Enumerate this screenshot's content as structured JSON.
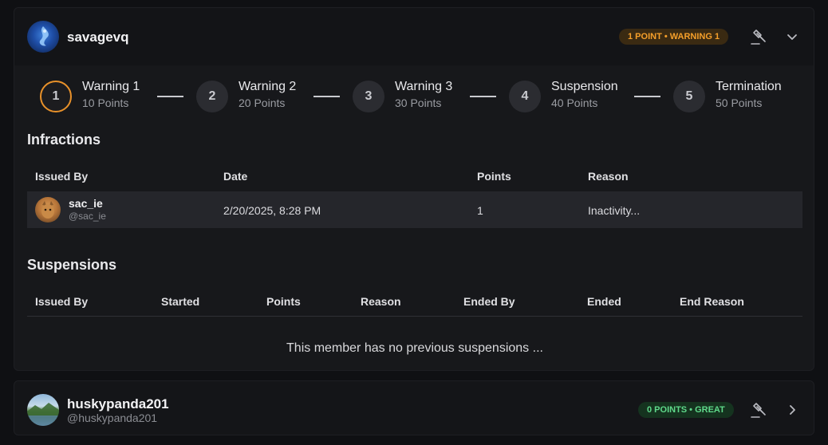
{
  "members": [
    {
      "username": "savagevq",
      "badge": "1 POINT • WARNING 1",
      "badge_color": "#f59f2a",
      "expanded": true
    },
    {
      "username": "huskypanda201",
      "handle": "@huskypanda201",
      "badge": "0 POINTS • GREAT",
      "badge_color": "#5fd98a",
      "expanded": false
    }
  ],
  "stepper": [
    {
      "number": "1",
      "title": "Warning 1",
      "points": "10 Points",
      "active": true
    },
    {
      "number": "2",
      "title": "Warning 2",
      "points": "20 Points",
      "active": false
    },
    {
      "number": "3",
      "title": "Warning 3",
      "points": "30 Points",
      "active": false
    },
    {
      "number": "4",
      "title": "Suspension",
      "points": "40 Points",
      "active": false
    },
    {
      "number": "5",
      "title": "Termination",
      "points": "50 Points",
      "active": false
    }
  ],
  "infractions": {
    "title": "Infractions",
    "columns": [
      "Issued By",
      "Date",
      "Points",
      "Reason"
    ],
    "rows": [
      {
        "issuer_name": "sac_ie",
        "issuer_handle": "@sac_ie",
        "date": "2/20/2025, 8:28 PM",
        "points": "1",
        "reason": "Inactivity..."
      }
    ]
  },
  "suspensions": {
    "title": "Suspensions",
    "columns": [
      "Issued By",
      "Started",
      "Points",
      "Reason",
      "Ended By",
      "Ended",
      "End Reason"
    ],
    "empty_message": "This member has no previous suspensions ..."
  },
  "icons": {
    "moderate": "gavel-icon",
    "collapse": "chevron-down-icon",
    "expand": "chevron-right-icon"
  },
  "colors": {
    "accent_active_step": "#e8912a",
    "background": "#0f1013",
    "card": "#17181b"
  }
}
